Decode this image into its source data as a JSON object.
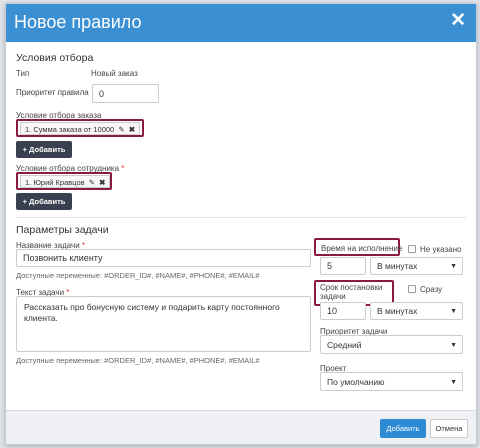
{
  "modal": {
    "title": "Новое правило",
    "close_icon": "close-icon"
  },
  "selection": {
    "section_title": "Условия отбора",
    "type_label": "Тип",
    "type_value": "Новый заказ",
    "priority_label": "Приоритет правила",
    "priority_value": "0",
    "order_condition_label": "Условие отбора заказа",
    "order_condition_chip": "1. Сумма заказа от 10000",
    "add_button_1": "+ Добавить",
    "employee_condition_label": "Условие отбора сотрудника",
    "required_mark": "*",
    "employee_condition_chip": "1. Юрий Кравцов",
    "add_button_2": "+ Добавить"
  },
  "task": {
    "section_title": "Параметры задачи",
    "name_label": "Название задачи",
    "name_value": "Позвонить клиенту",
    "name_vars": "Доступные переменные: #ORDER_ID#, #NAME#, #PHONE#, #EMAIL#",
    "text_label": "Текст задачи",
    "text_value": "Рассказать про бонусную систему и подарить карту постоянного клиента.",
    "text_vars": "Доступные переменные: #ORDER_ID#, #NAME#, #PHONE#, #EMAIL#",
    "exec_time_label": "Время на исполнение",
    "not_specified_label": "Не указано",
    "exec_time_value": "5",
    "exec_time_unit": "В минутах",
    "deadline_label_1": "Срок постановки",
    "deadline_label_2": "задачи",
    "immediately_label": "Сразу",
    "deadline_value": "10",
    "deadline_unit": "В минутах",
    "priority_label": "Приоритет задачи",
    "priority_value": "Средний",
    "project_label": "Проект",
    "project_value": "По умолчанию"
  },
  "footer": {
    "add_button": "Добавить",
    "cancel_button": "Отмена"
  }
}
